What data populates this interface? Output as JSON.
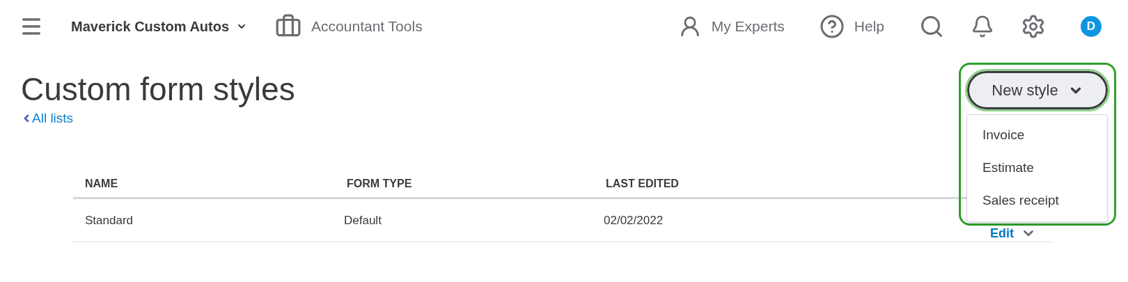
{
  "topbar": {
    "company": "Maverick Custom Autos",
    "accountant_tools": "Accountant Tools",
    "my_experts": "My Experts",
    "help": "Help",
    "avatar": "D"
  },
  "page": {
    "title": "Custom form styles",
    "back_link": "All lists"
  },
  "new_style": {
    "label": "New style",
    "expanded": true,
    "highlighted": true,
    "menu": [
      {
        "label": "Invoice"
      },
      {
        "label": "Estimate"
      },
      {
        "label": "Sales receipt"
      }
    ]
  },
  "table": {
    "columns": [
      "NAME",
      "FORM TYPE",
      "LAST EDITED"
    ],
    "rows": [
      {
        "name": "Standard",
        "form_type": "Default",
        "last_edited": "02/02/2022",
        "action": "Edit"
      }
    ]
  }
}
